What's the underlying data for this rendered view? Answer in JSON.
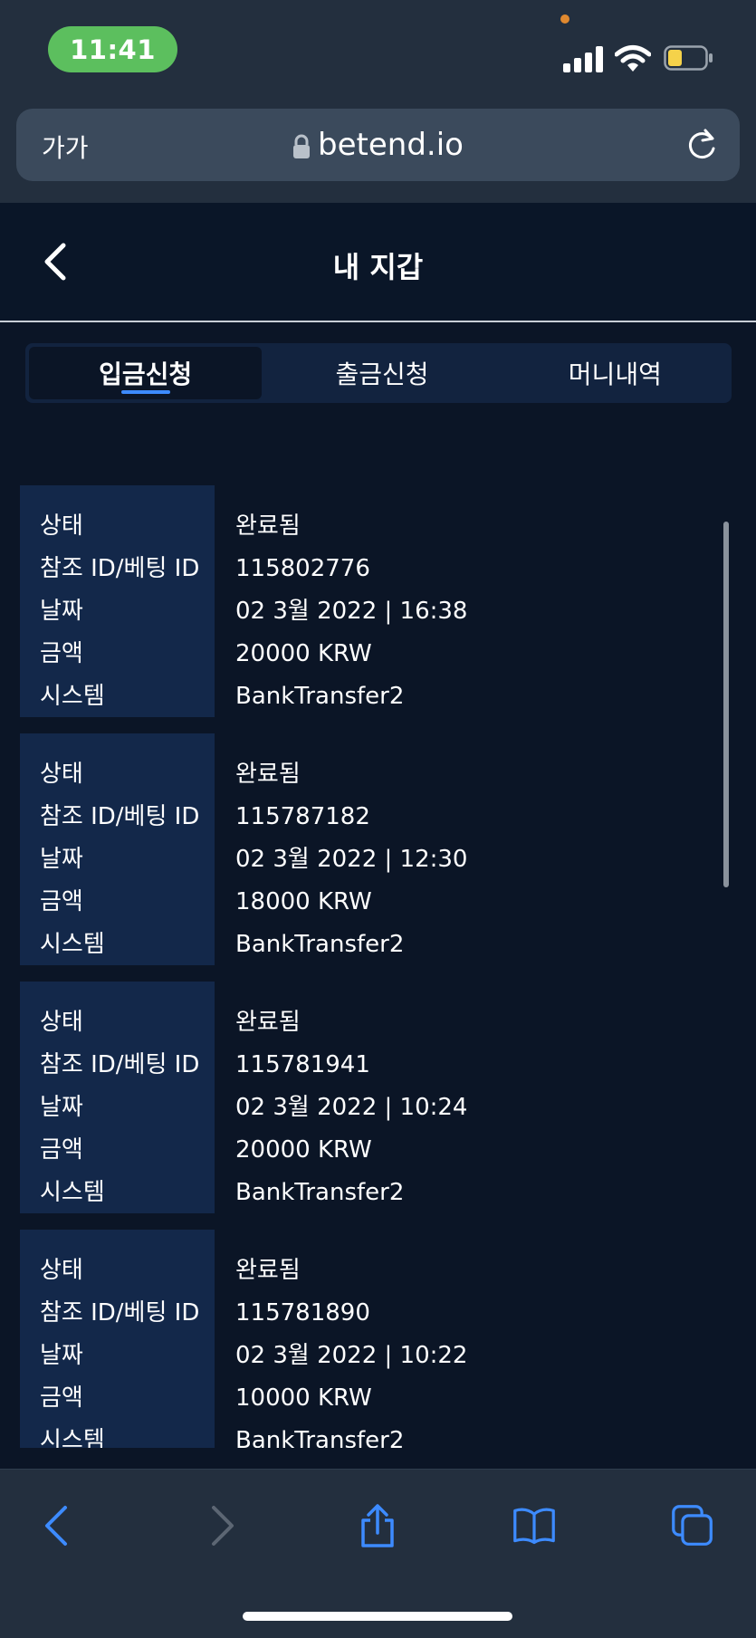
{
  "status_bar": {
    "time": "11:41"
  },
  "browser": {
    "text_size_label": "가가",
    "url": "betend.io"
  },
  "header": {
    "title": "내 지갑"
  },
  "tabs": [
    {
      "label": "입금신청",
      "active": true
    },
    {
      "label": "출금신청",
      "active": false
    },
    {
      "label": "머니내역",
      "active": false
    }
  ],
  "field_labels": {
    "status": "상태",
    "ref_id": "참조 ID/베팅 ID",
    "date": "날짜",
    "amount": "금액",
    "system": "시스템"
  },
  "transactions": [
    {
      "status": "완료됨",
      "ref_id": "115802776",
      "date": "02 3월 2022 | 16:38",
      "amount": "20000 KRW",
      "system": "BankTransfer2"
    },
    {
      "status": "완료됨",
      "ref_id": "115787182",
      "date": "02 3월 2022 | 12:30",
      "amount": "18000 KRW",
      "system": "BankTransfer2"
    },
    {
      "status": "완료됨",
      "ref_id": "115781941",
      "date": "02 3월 2022 | 10:24",
      "amount": "20000 KRW",
      "system": "BankTransfer2"
    },
    {
      "status": "완료됨",
      "ref_id": "115781890",
      "date": "02 3월 2022 | 10:22",
      "amount": "10000 KRW",
      "system": "BankTransfer2"
    }
  ],
  "colors": {
    "background": "#0b1526",
    "label_column": "#13284a",
    "tab_bar": "#12233f",
    "accent": "#3d8bff",
    "time_pill": "#5cbf5e"
  }
}
